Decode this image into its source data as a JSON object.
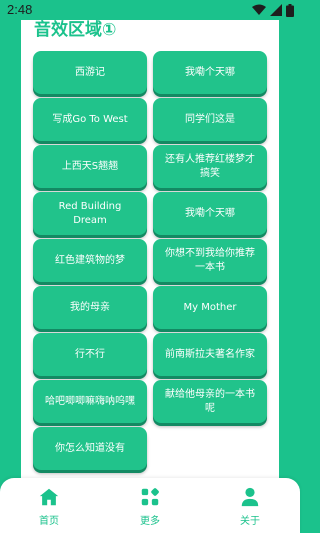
{
  "status_bar": {
    "time": "2:48"
  },
  "section": {
    "title": "音效区域①"
  },
  "buttons": [
    "西游记",
    "我嘞个天哪",
    "写成Go To West",
    "同学们这是",
    "上西天S翘翘",
    "还有人推荐红楼梦才搞笑",
    "Red Building Dream",
    "我嘞个天哪",
    "红色建筑物的梦",
    "你想不到我给你推荐一本书",
    "我的母亲",
    "My Mother",
    "行不行",
    "前南斯拉夫著名作家",
    "哈吧唧唧嘛嗨呐呜嘿",
    "献给他母亲的一本书呢",
    "你怎么知道没有"
  ],
  "nav": {
    "home": "首页",
    "more": "更多",
    "about": "关于"
  },
  "colors": {
    "accent": "#1bc28c",
    "button": "#21c38b",
    "button_shadow": "#138a63"
  }
}
